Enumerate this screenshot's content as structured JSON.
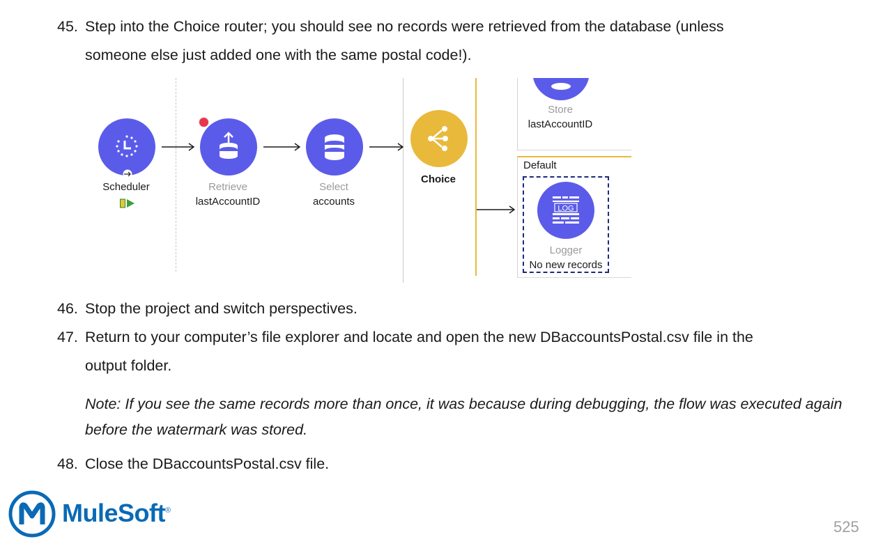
{
  "steps": [
    {
      "num": "45.",
      "line1": "Step into the Choice router; you should see no records were retrieved from the database (unless",
      "line2": "someone else just added one with the same postal code!)."
    },
    {
      "num": "46.",
      "line1": "Stop the project and switch perspectives."
    },
    {
      "num": "47.",
      "line1": "Return to your computer’s file explorer and locate and open the new DBaccountsPostal.csv file in the",
      "line2": "output folder."
    },
    {
      "num": "48.",
      "line1": "Close the DBaccountsPostal.csv file."
    }
  ],
  "note": "Note: If you see the same records more than once, it was because during debugging, the flow was executed again before the watermark was stored.",
  "flow": {
    "scheduler": {
      "name": "Scheduler"
    },
    "retrieve": {
      "type": "Retrieve",
      "name": "lastAccountID"
    },
    "select": {
      "type": "Select",
      "name": "accounts"
    },
    "choice": {
      "name": "Choice"
    },
    "store": {
      "type": "Store",
      "name": "lastAccountID"
    },
    "default_label": "Default",
    "logger": {
      "type": "Logger",
      "name": "No new records",
      "icon_text": "LOG"
    }
  },
  "colors": {
    "component": "#5b5bea",
    "choice": "#e9b93b",
    "selection": "#1a2a7c",
    "breakpoint": "#e8364a",
    "brand": "#0a6ab5"
  },
  "footer": {
    "brand": "MuleSoft",
    "trademark": "®",
    "page_number": "525"
  }
}
